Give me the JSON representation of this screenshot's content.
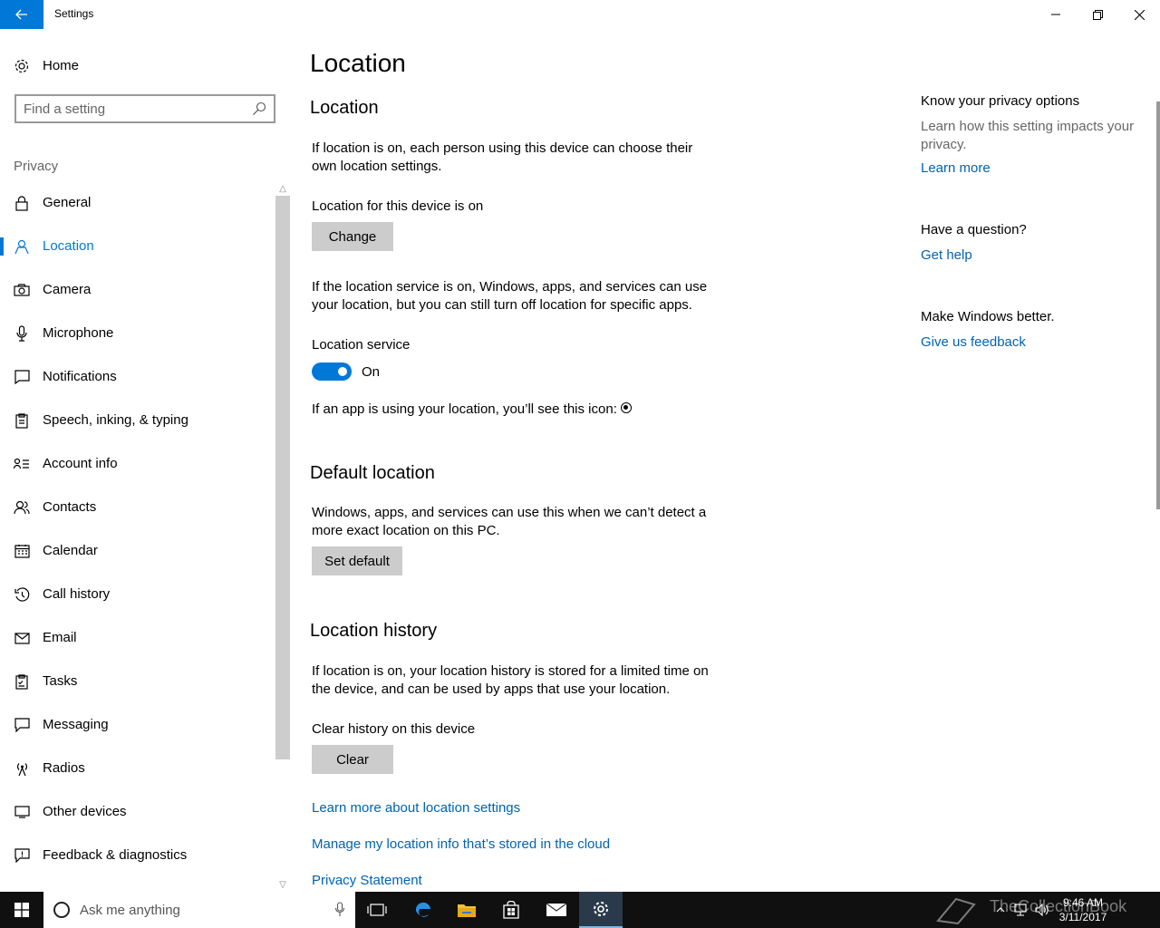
{
  "window": {
    "app_title": "Settings",
    "controls": {
      "minimize_icon": "minimize-icon",
      "restore_icon": "restore-icon",
      "close_icon": "close-icon"
    }
  },
  "sidebar": {
    "home_label": "Home",
    "search_placeholder": "Find a setting",
    "group_label": "Privacy",
    "items": [
      {
        "label": "General",
        "icon": "lock-icon",
        "active": false
      },
      {
        "label": "Location",
        "icon": "location-person-icon",
        "active": true
      },
      {
        "label": "Camera",
        "icon": "camera-icon",
        "active": false
      },
      {
        "label": "Microphone",
        "icon": "microphone-icon",
        "active": false
      },
      {
        "label": "Notifications",
        "icon": "notification-icon",
        "active": false
      },
      {
        "label": "Speech, inking, & typing",
        "icon": "clipboard-icon",
        "active": false
      },
      {
        "label": "Account info",
        "icon": "account-info-icon",
        "active": false
      },
      {
        "label": "Contacts",
        "icon": "contacts-icon",
        "active": false
      },
      {
        "label": "Calendar",
        "icon": "calendar-icon",
        "active": false
      },
      {
        "label": "Call history",
        "icon": "history-icon",
        "active": false
      },
      {
        "label": "Email",
        "icon": "mail-icon",
        "active": false
      },
      {
        "label": "Tasks",
        "icon": "tasks-icon",
        "active": false
      },
      {
        "label": "Messaging",
        "icon": "message-icon",
        "active": false
      },
      {
        "label": "Radios",
        "icon": "radio-tower-icon",
        "active": false
      },
      {
        "label": "Other devices",
        "icon": "devices-icon",
        "active": false
      },
      {
        "label": "Feedback & diagnostics",
        "icon": "feedback-icon",
        "active": false
      }
    ]
  },
  "main": {
    "page_title": "Location",
    "section_location": {
      "heading": "Location",
      "desc": "If location is on, each person using this device can choose their own location settings.",
      "device_status": "Location for this device is on",
      "change_button": "Change",
      "service_desc": "If the location service is on, Windows, apps, and services can use your location, but you can still turn off location for specific apps.",
      "service_label": "Location service",
      "service_state": "On",
      "service_on": true,
      "icon_note": "If an app is using your location, you’ll see this icon:"
    },
    "section_default": {
      "heading": "Default location",
      "desc": "Windows, apps, and services can use this when we can’t detect a more exact location on this PC.",
      "set_default_button": "Set default"
    },
    "section_history": {
      "heading": "Location history",
      "desc": "If location is on, your location history is stored for a limited time on the device, and can be used by apps that use your location.",
      "clear_label": "Clear history on this device",
      "clear_button": "Clear"
    },
    "links": {
      "learn_more": "Learn more about location settings",
      "manage_cloud": "Manage my location info that’s stored in the cloud",
      "privacy_statement": "Privacy Statement"
    }
  },
  "aside": {
    "privacy_title": "Know your privacy options",
    "privacy_desc": "Learn how this setting impacts your privacy.",
    "learn_more": "Learn more",
    "question_title": "Have a question?",
    "get_help": "Get help",
    "feedback_title": "Make Windows better.",
    "give_feedback": "Give us feedback"
  },
  "taskbar": {
    "search_placeholder": "Ask me anything",
    "time": "9:46 AM",
    "date": "3/11/2017",
    "watermark": "TheCollectionBook"
  },
  "colors": {
    "accent": "#0078d7",
    "link": "#0063b1",
    "button_bg": "#cccccc",
    "taskbar_bg": "#101010"
  }
}
